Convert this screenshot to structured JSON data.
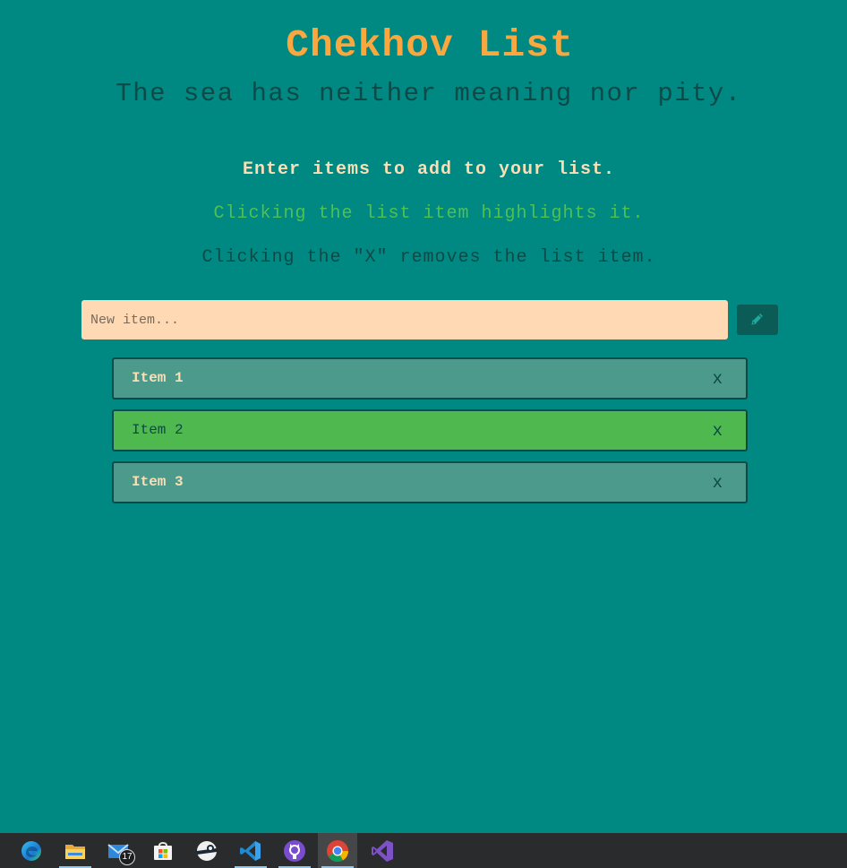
{
  "header": {
    "title": "Chekhov List",
    "subtitle": "The sea has neither meaning nor pity."
  },
  "instructions": {
    "line1": "Enter items to add to your list.",
    "line2": "Clicking the list item highlights it.",
    "line3": "Clicking the \"X\" removes the list item."
  },
  "input": {
    "placeholder": "New item...",
    "value": ""
  },
  "add_button": {
    "icon": "pencil-icon"
  },
  "list": {
    "items": [
      {
        "label": "Item 1",
        "remove": "x",
        "highlighted": false
      },
      {
        "label": "Item 2",
        "remove": "x",
        "highlighted": true
      },
      {
        "label": "Item 3",
        "remove": "x",
        "highlighted": false
      }
    ]
  },
  "taskbar": {
    "apps": [
      {
        "name": "edge-icon",
        "running": false
      },
      {
        "name": "file-explorer-icon",
        "running": true
      },
      {
        "name": "mail-icon",
        "running": false,
        "badge": "17"
      },
      {
        "name": "microsoft-store-icon",
        "running": false
      },
      {
        "name": "steam-icon",
        "running": false
      },
      {
        "name": "vscode-icon",
        "running": true
      },
      {
        "name": "github-desktop-icon",
        "running": true
      },
      {
        "name": "chrome-icon",
        "running": true,
        "active": true
      },
      {
        "name": "visual-studio-icon",
        "running": false
      }
    ]
  },
  "colors": {
    "background": "#008882",
    "title": "#f9a73e",
    "dark_teal": "#0d4a47",
    "cream": "#fadfb6",
    "green": "#4fc153",
    "input_bg": "#ffd9b3",
    "item_bg": "#4c9a8c",
    "item_highlight_bg": "#4fb94f"
  }
}
